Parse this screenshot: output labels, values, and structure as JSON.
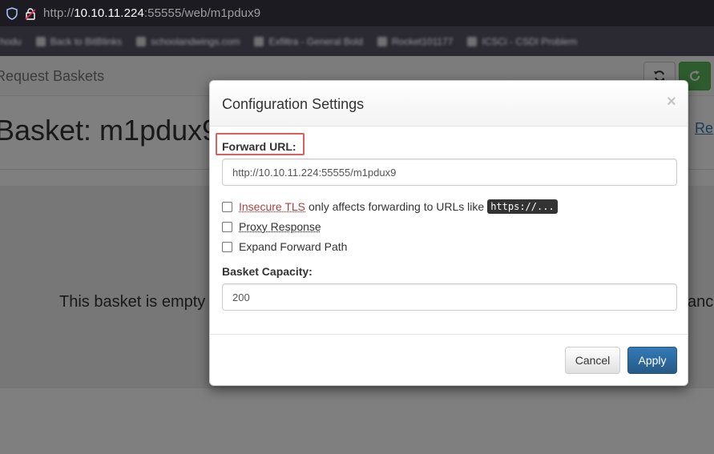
{
  "browser": {
    "url_prefix": "http://",
    "url_host": "10.10.11.224",
    "url_rest": ":55555/web/m1pdux9",
    "bookmarks": [
      "hodu",
      "Back to BitBlinks",
      "schoolandwings.com",
      "Exfiltra - General Bold",
      "Rocket101177",
      "ICSCi - CSDI Problem"
    ]
  },
  "page": {
    "brand": "Request Baskets",
    "basket_title": "Basket: m1pdux9",
    "requests_link": "Re",
    "empty_message": "This basket is empty",
    "empty_tail": "anc"
  },
  "modal": {
    "title": "Configuration Settings",
    "close_symbol": "×",
    "forward_url_label": "Forward URL:",
    "forward_url_value": "http://10.10.11.224:55555/m1pdux9",
    "insecure_tls_label": "Insecure TLS",
    "insecure_tls_desc": "only affects forwarding to URLs like",
    "insecure_tls_code": "https://...",
    "insecure_tls_checked": false,
    "proxy_response_label": "Proxy Response",
    "proxy_response_checked": false,
    "expand_path_label": "Expand Forward Path",
    "expand_path_checked": false,
    "capacity_label": "Basket Capacity:",
    "capacity_value": "200",
    "cancel_label": "Cancel",
    "apply_label": "Apply"
  },
  "colors": {
    "apply_bg": "#337ab7",
    "highlight_border": "#e05d5d",
    "insecure_text": "#a94442",
    "browser_bar": "#1c1b22"
  },
  "icons": [
    "shield-icon",
    "lock-insecure-icon",
    "refresh-icon",
    "reload-icon"
  ]
}
